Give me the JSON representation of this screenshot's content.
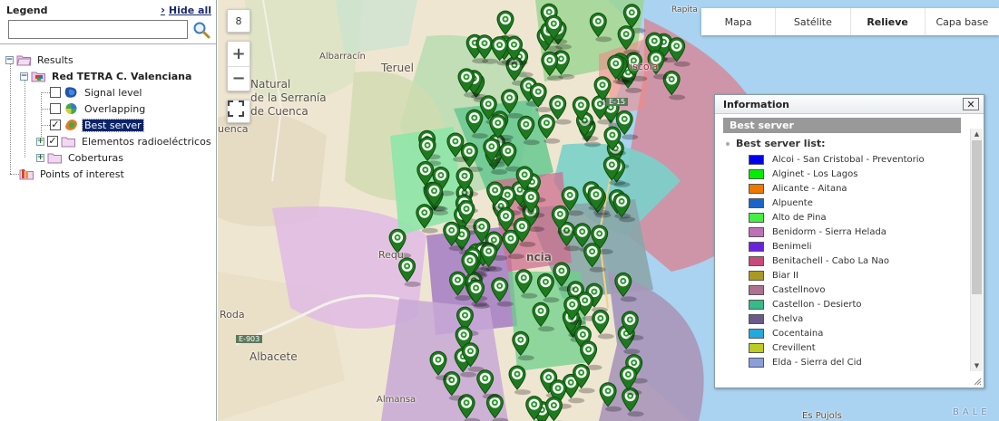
{
  "legend": {
    "title": "Legend",
    "hide_all": "Hide all",
    "search_value": "",
    "tree": {
      "results": "Results",
      "network": "Red TETRA C. Valenciana",
      "signal_level": "Signal level",
      "overlapping": "Overlapping",
      "best_server": "Best server",
      "elements": "Elementos radioeléctricos",
      "coberturas": "Coberturas",
      "points": "Points of interest"
    }
  },
  "map": {
    "zoom_level": "8",
    "zoom_in": "+",
    "zoom_out": "−",
    "basemaps": [
      "Mapa",
      "Satélite",
      "Relieve",
      "Capa base"
    ],
    "active_basemap": "Relieve",
    "labels": {
      "albarracin": "Albarracín",
      "teruel": "Teruel",
      "parque1": "Natural",
      "parque2": "de la Serranía",
      "parque3": "de Cuenca",
      "cuenca": "uenca",
      "roda": "Roda",
      "albacete": "Albacete",
      "almansa": "Almansa",
      "road": "E-903",
      "road2": "E-15",
      "vinaros": "iscola",
      "requena": "Requ",
      "valencia": "ncia",
      "elx": "Es Pujols",
      "sea": "BALE",
      "rapita": "Rapita"
    }
  },
  "info": {
    "title": "Information",
    "section": "Best server",
    "subtitle": "Best server list:",
    "servers": [
      {
        "name": "Alcoi - San Cristobal - Preventorio",
        "color": "#0000ee"
      },
      {
        "name": "Alginet - Los Lagos",
        "color": "#00ee00"
      },
      {
        "name": "Alicante - Aitana",
        "color": "#ee7700"
      },
      {
        "name": "Alpuente",
        "color": "#1a66c8"
      },
      {
        "name": "Alto de Pina",
        "color": "#44ee44"
      },
      {
        "name": "Benidorm - Sierra Helada",
        "color": "#c070b8"
      },
      {
        "name": "Benimeli",
        "color": "#6a22dd"
      },
      {
        "name": "Benitachell - Cabo La Nao",
        "color": "#c84a7a"
      },
      {
        "name": "Biar II",
        "color": "#aa9a22"
      },
      {
        "name": "Castellnovo",
        "color": "#b07090"
      },
      {
        "name": "Castellon - Desierto",
        "color": "#33bb88"
      },
      {
        "name": "Chelva",
        "color": "#6a5a8a"
      },
      {
        "name": "Cocentaina",
        "color": "#22aadd"
      },
      {
        "name": "Crevillent",
        "color": "#bbcc22"
      },
      {
        "name": "Elda - Sierra del Cid",
        "color": "#8aa0dd"
      },
      {
        "name": "",
        "color": "#a07ab0"
      }
    ]
  }
}
